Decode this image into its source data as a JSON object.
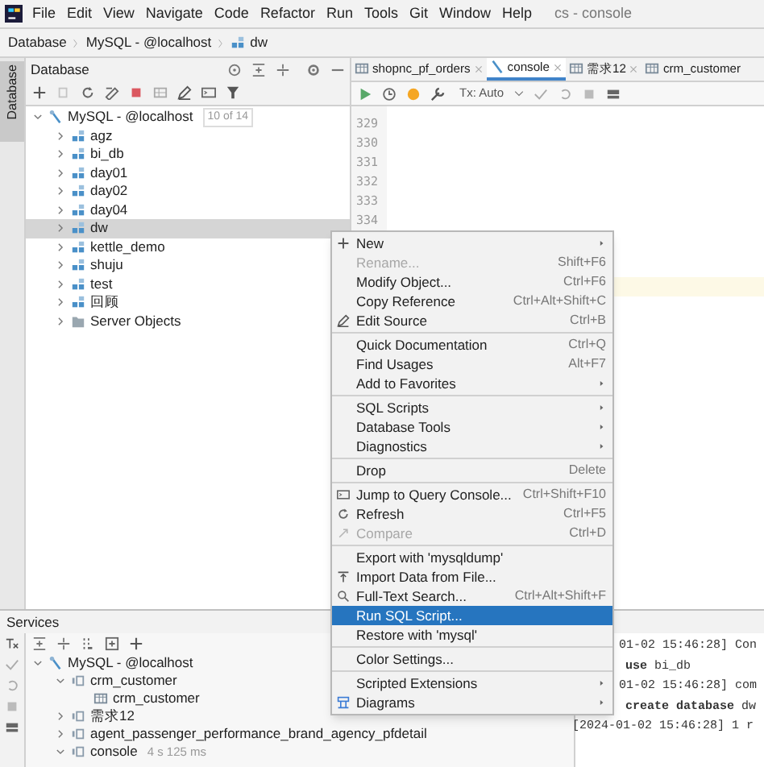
{
  "menu_bar": {
    "items": [
      "File",
      "Edit",
      "View",
      "Navigate",
      "Code",
      "Refactor",
      "Run",
      "Tools",
      "Git",
      "Window",
      "Help"
    ],
    "title": "cs - console"
  },
  "breadcrumb": [
    "Database",
    "MySQL - @localhost",
    "dw"
  ],
  "tool_strip": {
    "label": "Database"
  },
  "database_panel": {
    "title": "Database",
    "tree": [
      {
        "label": "MySQL - @localhost",
        "badge": "10 of 14",
        "kind": "server",
        "expanded": true,
        "children": [
          {
            "label": "agz",
            "kind": "schema",
            "expanded": false,
            "selected": false
          },
          {
            "label": "bi_db",
            "kind": "schema",
            "expanded": false,
            "selected": false
          },
          {
            "label": "day01",
            "kind": "schema",
            "expanded": false,
            "selected": false
          },
          {
            "label": "day02",
            "kind": "schema",
            "expanded": false,
            "selected": false
          },
          {
            "label": "day04",
            "kind": "schema",
            "expanded": false,
            "selected": false
          },
          {
            "label": "dw",
            "kind": "schema",
            "expanded": false,
            "selected": true
          },
          {
            "label": "kettle_demo",
            "kind": "schema",
            "expanded": false,
            "selected": false
          },
          {
            "label": "shuju",
            "kind": "schema",
            "expanded": false,
            "selected": false
          },
          {
            "label": "test",
            "kind": "schema",
            "expanded": false,
            "selected": false
          },
          {
            "label": "回顾",
            "kind": "schema",
            "expanded": false,
            "selected": false
          },
          {
            "label": "Server Objects",
            "kind": "folder",
            "expanded": false,
            "selected": false
          }
        ]
      }
    ]
  },
  "editor": {
    "tabs": [
      {
        "label": "shopnc_pf_orders",
        "kind": "table",
        "selected": false
      },
      {
        "label": "console",
        "kind": "console",
        "selected": true
      },
      {
        "label": "需求12",
        "kind": "table",
        "selected": false
      },
      {
        "label": "crm_customer",
        "kind": "table",
        "selected": false
      }
    ],
    "tx_mode": "Tx: Auto",
    "line_numbers": [
      "329",
      "330",
      "331",
      "332",
      "333",
      "334"
    ]
  },
  "context_menu": {
    "sections": [
      [
        {
          "label": "New",
          "submenu": true,
          "disabled": false,
          "selected": false
        },
        {
          "label": "Rename...",
          "shortcut": "Shift+F6",
          "disabled": true,
          "selected": false
        },
        {
          "label": "Modify Object...",
          "shortcut": "Ctrl+F6",
          "disabled": false,
          "selected": false
        },
        {
          "label": "Copy Reference",
          "shortcut": "Ctrl+Alt+Shift+C",
          "disabled": false,
          "selected": false
        },
        {
          "label": "Edit Source",
          "shortcut": "Ctrl+B",
          "disabled": false,
          "selected": false
        }
      ],
      [
        {
          "label": "Quick Documentation",
          "shortcut": "Ctrl+Q",
          "disabled": false,
          "selected": false
        },
        {
          "label": "Find Usages",
          "shortcut": "Alt+F7",
          "disabled": false,
          "selected": false
        },
        {
          "label": "Add to Favorites",
          "submenu": true,
          "disabled": false,
          "selected": false
        }
      ],
      [
        {
          "label": "SQL Scripts",
          "submenu": true,
          "disabled": false,
          "selected": false
        },
        {
          "label": "Database Tools",
          "submenu": true,
          "disabled": false,
          "selected": false
        },
        {
          "label": "Diagnostics",
          "submenu": true,
          "disabled": false,
          "selected": false
        }
      ],
      [
        {
          "label": "Drop",
          "shortcut": "Delete",
          "disabled": false,
          "selected": false
        }
      ],
      [
        {
          "label": "Jump to Query Console...",
          "shortcut": "Ctrl+Shift+F10",
          "disabled": false,
          "selected": false
        },
        {
          "label": "Refresh",
          "shortcut": "Ctrl+F5",
          "disabled": false,
          "selected": false
        },
        {
          "label": "Compare",
          "shortcut": "Ctrl+D",
          "disabled": true,
          "selected": false
        }
      ],
      [
        {
          "label": "Export with 'mysqldump'",
          "disabled": false,
          "selected": false
        },
        {
          "label": "Import Data from File...",
          "disabled": false,
          "selected": false
        },
        {
          "label": "Full-Text Search...",
          "shortcut": "Ctrl+Alt+Shift+F",
          "disabled": false,
          "selected": false
        },
        {
          "label": "Run SQL Script...",
          "disabled": false,
          "selected": true
        },
        {
          "label": "Restore with 'mysql'",
          "disabled": false,
          "selected": false
        }
      ],
      [
        {
          "label": "Color Settings...",
          "disabled": false,
          "selected": false
        }
      ],
      [
        {
          "label": "Scripted Extensions",
          "submenu": true,
          "disabled": false,
          "selected": false
        },
        {
          "label": "Diagrams",
          "submenu": true,
          "disabled": false,
          "selected": false
        }
      ]
    ]
  },
  "services": {
    "title": "Services",
    "tree": [
      {
        "label": "MySQL - @localhost",
        "kind": "server",
        "expanded": true,
        "children": [
          {
            "label": "crm_customer",
            "kind": "session",
            "expanded": true,
            "children": [
              {
                "label": "crm_customer",
                "kind": "table"
              }
            ]
          },
          {
            "label": "需求12",
            "kind": "session",
            "expanded": false
          },
          {
            "label": "agent_passenger_performance_brand_agency_pfdetail",
            "kind": "session",
            "expanded": false
          },
          {
            "label": "console",
            "detail": "4 s 125 ms",
            "kind": "session",
            "expanded": true
          }
        ]
      }
    ],
    "output": [
      {
        "kind": "log",
        "text": "01-02 15:46:28] Con"
      },
      {
        "kind": "sql",
        "text": "**use** bi_db"
      },
      {
        "kind": "log",
        "text": "01-02 15:46:28] com"
      },
      {
        "kind": "sql",
        "text": "**create database** dw"
      },
      {
        "kind": "result",
        "text": "[2024-01-02 15:46:28] 1 r"
      }
    ]
  }
}
